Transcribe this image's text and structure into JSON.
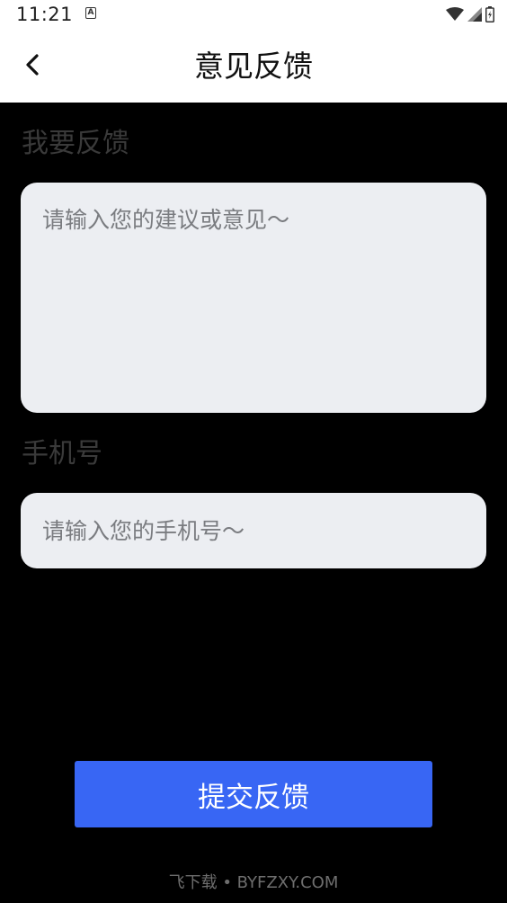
{
  "status_bar": {
    "time": "11:21",
    "notification_icon": "a-badge-icon",
    "a_letter": "A",
    "icons": [
      "wifi-icon",
      "signal-icon",
      "battery-icon"
    ]
  },
  "header": {
    "back_icon": "chevron-left-icon",
    "title": "意见反馈"
  },
  "feedback": {
    "label": "我要反馈",
    "placeholder": "请输入您的建议或意见～",
    "value": ""
  },
  "phone": {
    "label": "手机号",
    "placeholder": "请输入您的手机号～",
    "value": ""
  },
  "submit": {
    "label": "提交反馈"
  },
  "watermark": {
    "text": "飞下载 • BYFZXY.COM"
  },
  "colors": {
    "background": "#000000",
    "header_background": "#ffffff",
    "input_background": "#eceef2",
    "accent": "#3866f4"
  }
}
